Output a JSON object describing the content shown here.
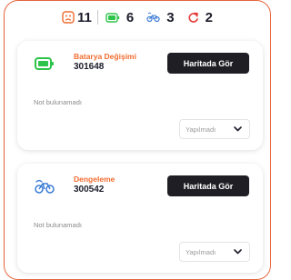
{
  "summary": {
    "items": [
      {
        "icon": "warning-face-icon",
        "count": "11",
        "color": "#f26b2e"
      },
      {
        "icon": "battery-icon",
        "count": "6",
        "color": "#2ec34a"
      },
      {
        "icon": "bicycle-icon",
        "count": "3",
        "color": "#3a7bd5"
      },
      {
        "icon": "refresh-icon",
        "count": "2",
        "color": "#e53935"
      }
    ]
  },
  "tasks": [
    {
      "icon": "battery-icon",
      "title": "Batarya Değişimi",
      "id": "301648",
      "map_button": "Haritada Gör",
      "note": "Not bulunamadı",
      "status": "Yapılmadı"
    },
    {
      "icon": "bicycle-icon",
      "title": "Dengeleme",
      "id": "300542",
      "map_button": "Haritada Gör",
      "note": "Not bulunamadı",
      "status": "Yapılmadı"
    }
  ],
  "colors": {
    "accent": "#f26b2e",
    "button_bg": "#1e1e24",
    "frame": "#e5643a"
  }
}
